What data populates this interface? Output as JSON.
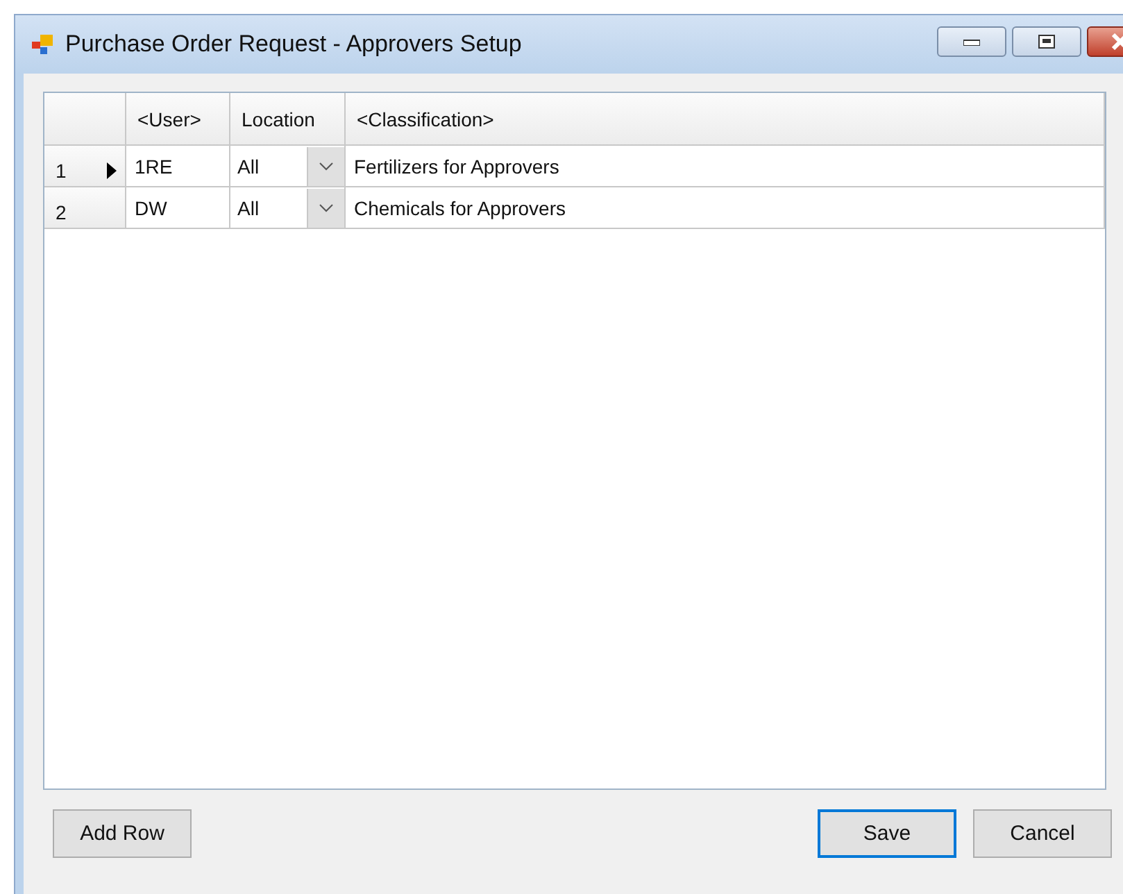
{
  "window": {
    "title": "Purchase Order Request - Approvers Setup"
  },
  "grid": {
    "columns": [
      "<User>",
      "Location",
      "<Classification>"
    ],
    "rows": [
      {
        "number": "1",
        "current": true,
        "user": "1RE",
        "location": "All",
        "classification": "Fertilizers for Approvers"
      },
      {
        "number": "2",
        "current": false,
        "user": "DW",
        "location": "All",
        "classification": "Chemicals for Approvers"
      }
    ]
  },
  "buttons": [
    {
      "label": "Add Row",
      "focused": false
    },
    {
      "label": "Save",
      "focused": true
    },
    {
      "label": "Cancel",
      "focused": false
    }
  ]
}
